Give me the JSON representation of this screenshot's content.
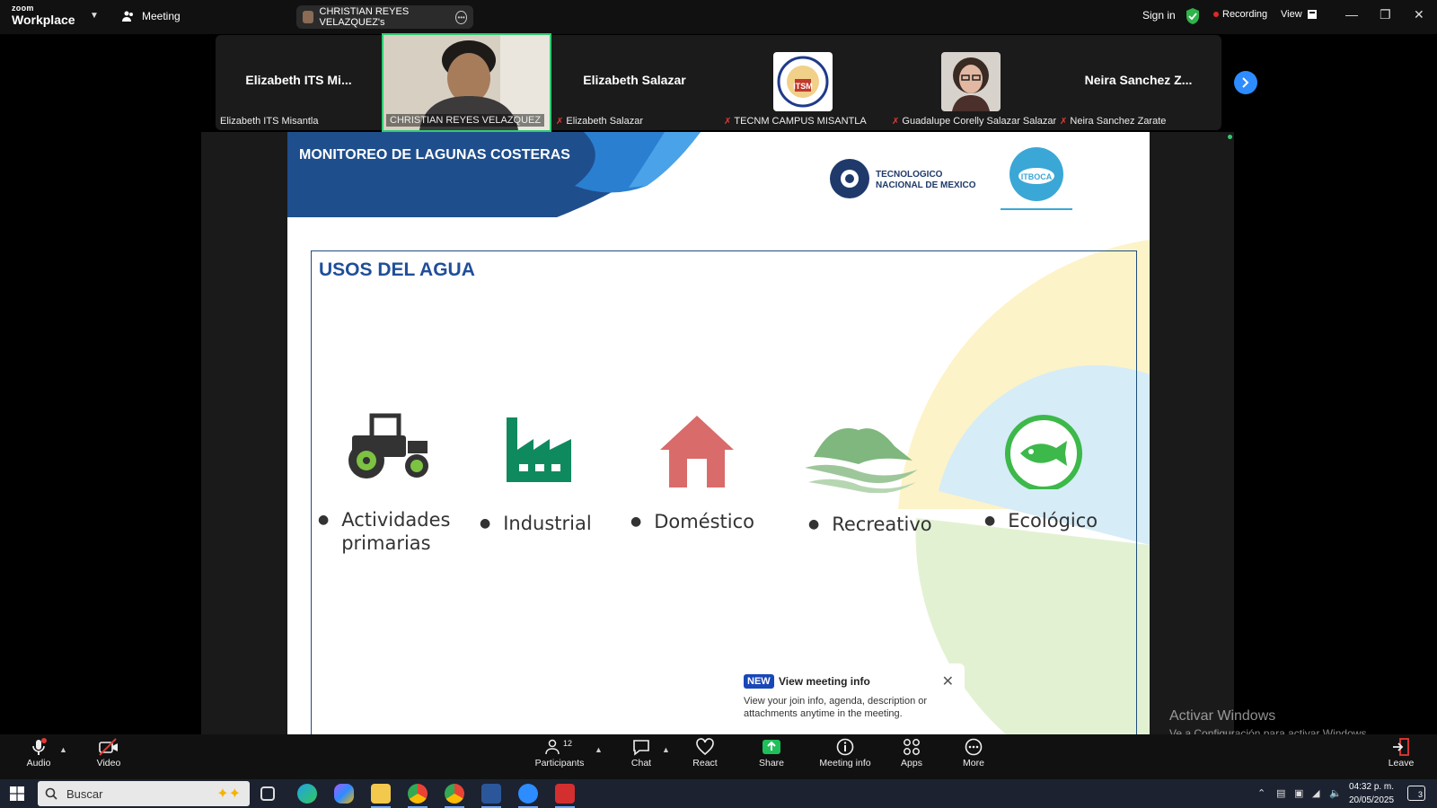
{
  "app": {
    "brand_top": "zoom",
    "brand_bottom": "Workplace",
    "meeting_label": "Meeting",
    "active_speaker": "CHRISTIAN REYES VELAZQUEZ's",
    "sign_in": "Sign in",
    "recording": "Recording",
    "view": "View"
  },
  "participants": [
    {
      "display_name": "Elizabeth ITS Mi...",
      "label": "Elizabeth ITS Misantla",
      "muted": false,
      "kind": "name"
    },
    {
      "display_name": "",
      "label": "CHRISTIAN REYES VELAZQUEZ",
      "muted": false,
      "kind": "video"
    },
    {
      "display_name": "Elizabeth Salazar",
      "label": "Elizabeth Salazar",
      "muted": true,
      "kind": "name"
    },
    {
      "display_name": "",
      "label": "TECNM CAMPUS MISANTLA",
      "muted": true,
      "kind": "logo"
    },
    {
      "display_name": "",
      "label": "Guadalupe Corelly Salazar Salazar",
      "muted": true,
      "kind": "photo"
    },
    {
      "display_name": "Neira Sanchez Z...",
      "label": "Neira Sanchez Zarate",
      "muted": true,
      "kind": "name"
    }
  ],
  "slide": {
    "header_title": "MONITOREO DE LAGUNAS COSTERAS",
    "tec_logo_text_line1": "TECNOLOGICO",
    "tec_logo_text_line2": "NACIONAL DE MEXICO",
    "itboca_logo_text": "ITBOCA",
    "section_title": "USOS DEL AGUA",
    "uses": [
      {
        "label_line1": "Actividades",
        "label_line2": "primarias",
        "icon": "tractor-icon",
        "color": "#7dc242"
      },
      {
        "label_line1": "Industrial",
        "label_line2": "",
        "icon": "factory-icon",
        "color": "#0f8a5f"
      },
      {
        "label_line1": "Doméstico",
        "label_line2": "",
        "icon": "house-icon",
        "color": "#d96b6b"
      },
      {
        "label_line1": "Recreativo",
        "label_line2": "",
        "icon": "beach-waves-icon",
        "color": "#7fb77e"
      },
      {
        "label_line1": "Ecológico",
        "label_line2": "",
        "icon": "fish-icon",
        "color": "#3db84a"
      }
    ]
  },
  "toast": {
    "badge": "NEW",
    "title": "View meeting info",
    "body": "View your join info, agenda, description or attachments anytime in the meeting."
  },
  "watermark": {
    "line1": "Activar Windows",
    "line2": "Ve a Configuración para activar Windows."
  },
  "toolbar": {
    "audio": "Audio",
    "video": "Video",
    "participants": "Participants",
    "participants_count": "12",
    "chat": "Chat",
    "react": "React",
    "share": "Share",
    "meeting_info": "Meeting info",
    "apps": "Apps",
    "more": "More",
    "leave": "Leave"
  },
  "taskbar": {
    "search_placeholder": "Buscar",
    "time": "04:32 p. m.",
    "date": "20/05/2025",
    "notification_count": "3"
  },
  "colors": {
    "zoom_blue": "#2d8cff",
    "slide_navy": "#1f4e9a",
    "share_green": "#1fbf5a",
    "recording_red": "#e02828"
  }
}
